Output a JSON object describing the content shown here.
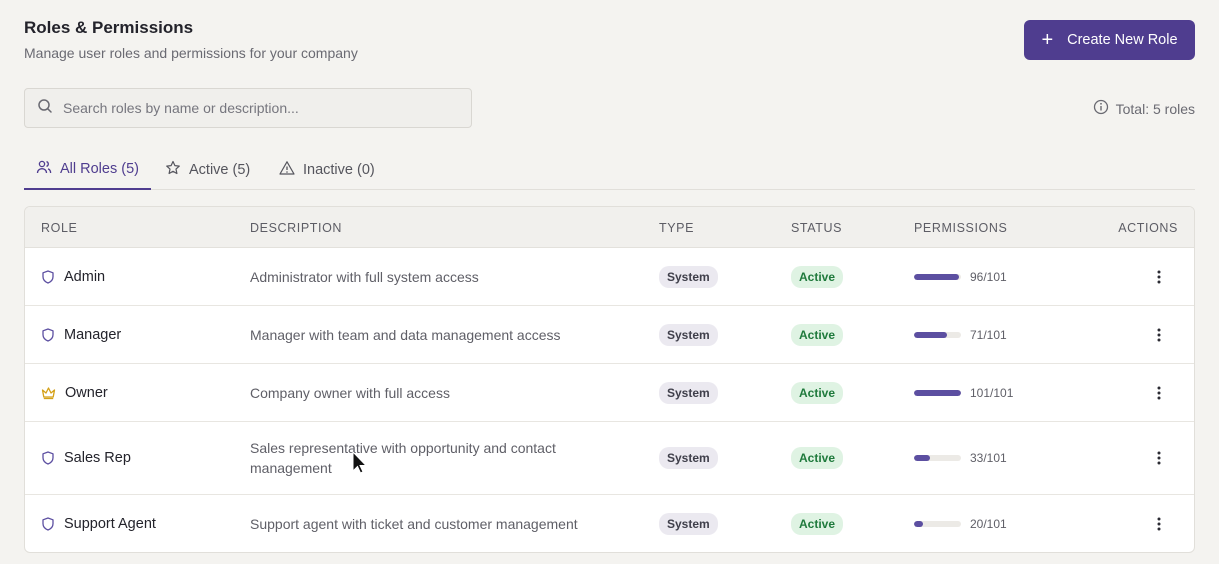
{
  "header": {
    "title": "Roles & Permissions",
    "subtitle": "Manage user roles and permissions for your company",
    "create_label": "Create New Role"
  },
  "search": {
    "placeholder": "Search roles by name or description...",
    "icon": "search-icon"
  },
  "total_label": "Total: 5 roles",
  "tabs": [
    {
      "label": "All Roles (5)",
      "icon": "users-icon",
      "active": true
    },
    {
      "label": "Active (5)",
      "icon": "star-icon",
      "active": false
    },
    {
      "label": "Inactive (0)",
      "icon": "warning-icon",
      "active": false
    }
  ],
  "table": {
    "headers": [
      "ROLE",
      "DESCRIPTION",
      "TYPE",
      "STATUS",
      "PERMISSIONS",
      "ACTIONS"
    ],
    "rows": [
      {
        "role": "Admin",
        "icon": "shield-icon",
        "description": "Administrator with full system access",
        "type": "System",
        "status": "Active",
        "permissions": "96/101",
        "perm_fraction": 0.95
      },
      {
        "role": "Manager",
        "icon": "shield-icon",
        "description": "Manager with team and data management access",
        "type": "System",
        "status": "Active",
        "permissions": "71/101",
        "perm_fraction": 0.7
      },
      {
        "role": "Owner",
        "icon": "crown-icon",
        "description": "Company owner with full access",
        "type": "System",
        "status": "Active",
        "permissions": "101/101",
        "perm_fraction": 1.0
      },
      {
        "role": "Sales Rep",
        "icon": "shield-icon",
        "description": "Sales representative with opportunity and contact management",
        "type": "System",
        "status": "Active",
        "permissions": "33/101",
        "perm_fraction": 0.33
      },
      {
        "role": "Support Agent",
        "icon": "shield-icon",
        "description": "Support agent with ticket and customer management",
        "type": "System",
        "status": "Active",
        "permissions": "20/101",
        "perm_fraction": 0.2
      }
    ]
  },
  "colors": {
    "accent": "#4f3d8f",
    "bar": "#5c4fa1",
    "active_bg": "#dff3e3",
    "active_text": "#1f7a3c",
    "crown": "#d4a017",
    "shield": "#5c4fa1"
  }
}
